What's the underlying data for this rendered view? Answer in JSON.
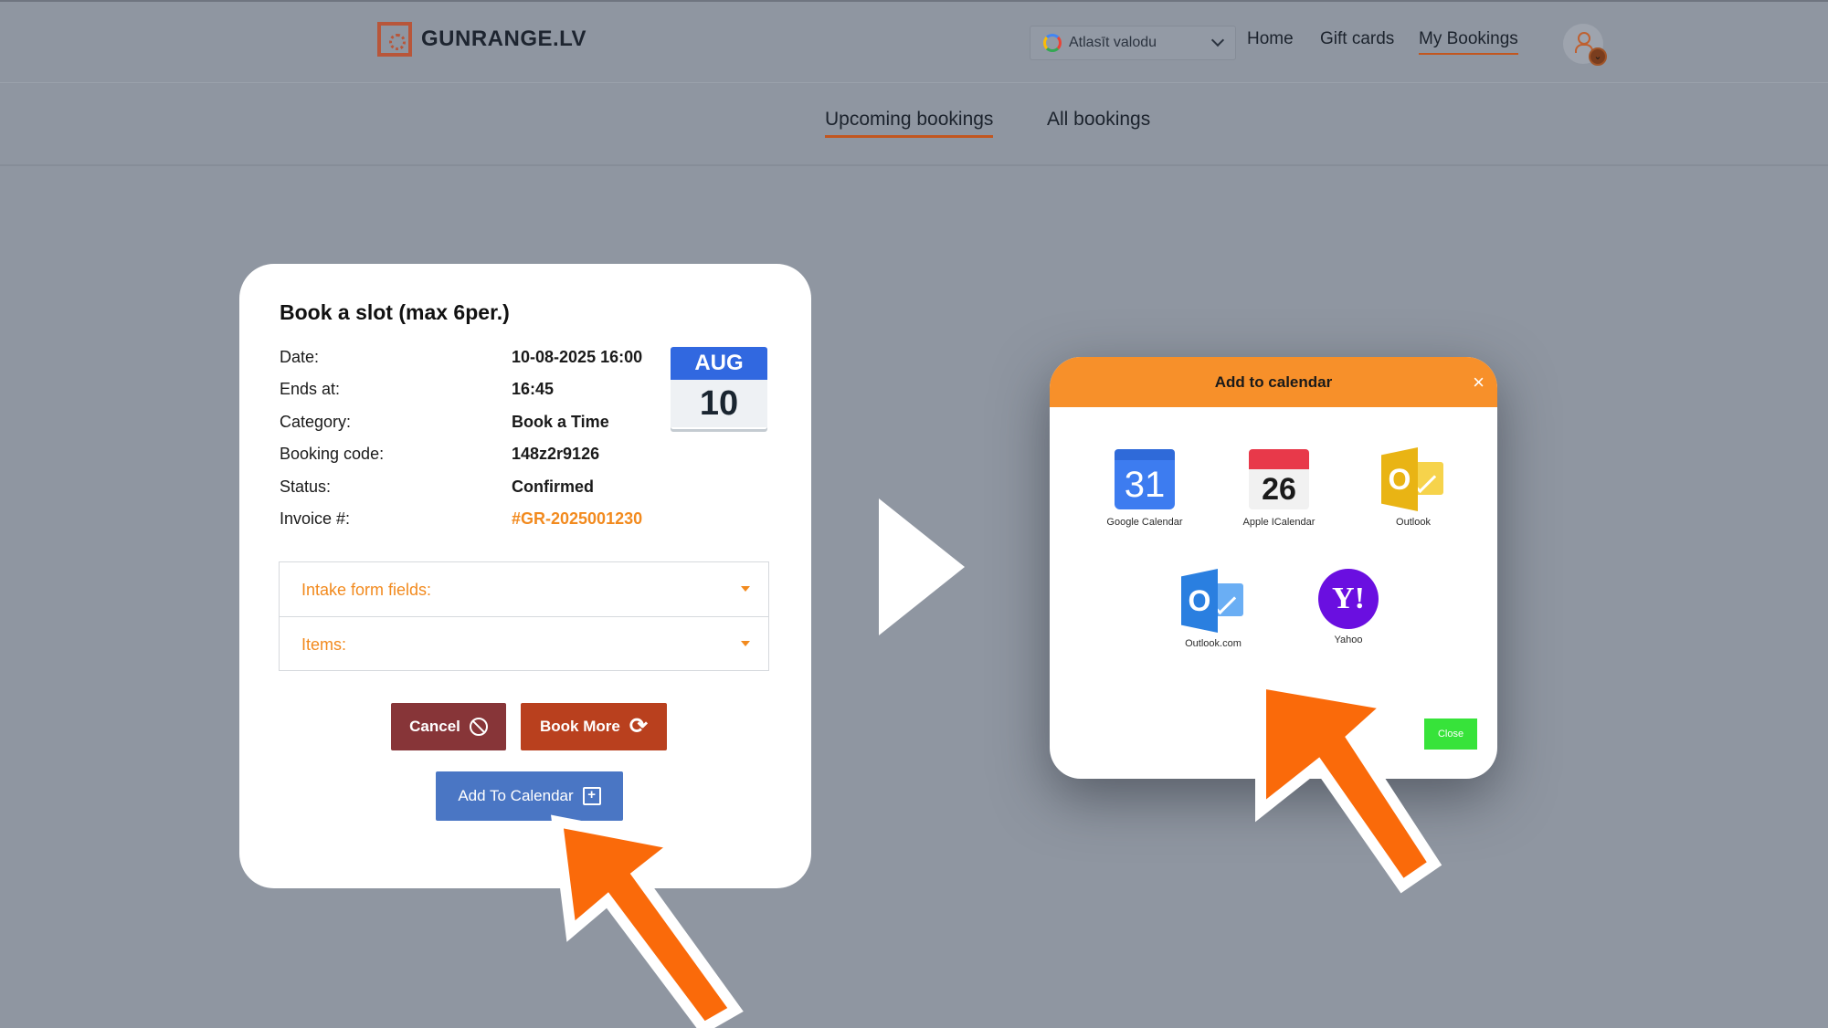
{
  "header": {
    "logo_text": "GUNRANGE.LV",
    "language_select": {
      "value": "Atlasīt valodu",
      "icon": "google-icon"
    },
    "nav": [
      {
        "label": "Home",
        "active": false
      },
      {
        "label": "Gift cards",
        "active": false
      },
      {
        "label": "My Bookings",
        "active": true
      }
    ],
    "avatar": {
      "icon": "user-icon",
      "badge_icon": "chevron-down-icon"
    }
  },
  "tabs": [
    {
      "label": "Upcoming bookings",
      "active": true
    },
    {
      "label": "All bookings",
      "active": false
    }
  ],
  "booking": {
    "title": "Book a slot (max 6per.)",
    "rows": [
      {
        "label": "Date:",
        "value": "10-08-2025 16:00"
      },
      {
        "label": "Ends at:",
        "value": "16:45"
      },
      {
        "label": "Category:",
        "value": "Book a Time"
      },
      {
        "label": "Booking code:",
        "value": "148z2r9126"
      },
      {
        "label": "Status:",
        "value": "Confirmed"
      },
      {
        "label": "Invoice #:",
        "value": "#GR-2025001230"
      }
    ],
    "date_badge": {
      "month": "AUG",
      "day": "10"
    },
    "accordion": [
      {
        "label": "Intake form fields:"
      },
      {
        "label": "Items:"
      }
    ],
    "buttons": {
      "cancel": "Cancel",
      "book_more": "Book More",
      "add_to_calendar": "Add To Calendar"
    }
  },
  "modal": {
    "title": "Add to calendar",
    "close_x": "×",
    "options": [
      {
        "label": "Google Calendar",
        "icon": "google-calendar-icon",
        "glyph": "31"
      },
      {
        "label": "Apple ICalendar",
        "icon": "apple-calendar-icon",
        "glyph": "26"
      },
      {
        "label": "Outlook",
        "icon": "outlook-icon",
        "glyph": "O"
      },
      {
        "label": "Outlook.com",
        "icon": "outlook-com-icon",
        "glyph": "O"
      },
      {
        "label": "Yahoo",
        "icon": "yahoo-icon",
        "glyph": "Y!"
      }
    ],
    "close_button": "Close"
  },
  "colors": {
    "accent_orange": "#f28a1e",
    "arrow_orange": "#fa6a0a",
    "cancel_red": "#873538",
    "book_more_red": "#b9401e",
    "calendar_blue": "#4a76c4",
    "close_green": "#37e33a"
  }
}
